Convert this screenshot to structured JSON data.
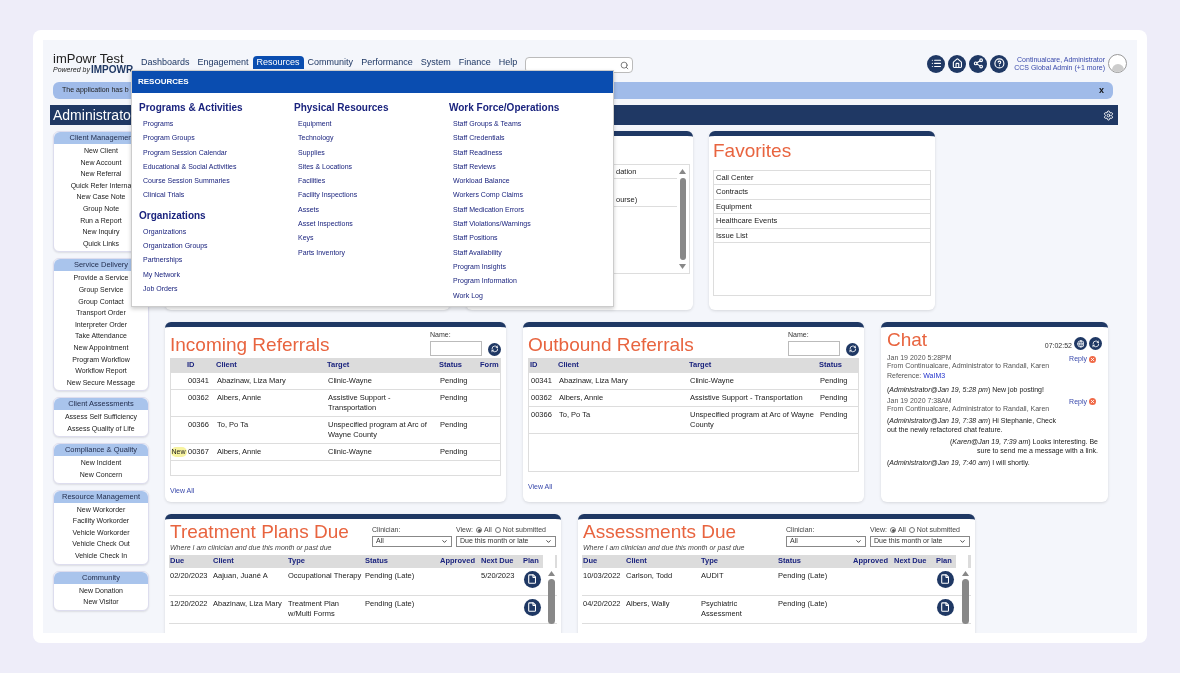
{
  "header": {
    "logo": {
      "title": "imPowr Test",
      "tagline": "Powered by",
      "brand": "IMPOWR"
    },
    "nav": [
      {
        "label": "Dashboards",
        "selected": false
      },
      {
        "label": "Engagement",
        "selected": false
      },
      {
        "label": "Resources",
        "selected": true
      },
      {
        "label": "Community",
        "selected": false
      },
      {
        "label": "Performance",
        "selected": false
      },
      {
        "label": "System",
        "selected": false
      },
      {
        "label": "Finance",
        "selected": false
      },
      {
        "label": "Help",
        "selected": false
      }
    ],
    "user": {
      "name": "Continualcare, Administrator",
      "role": "CCS Global Admin (+1 more)"
    }
  },
  "banner": {
    "text": "The application has b",
    "close": "x"
  },
  "page_title": "Administrato",
  "sidebar": [
    {
      "title": "Client Managemen",
      "items": [
        "New Client",
        "New Account",
        "New Referral",
        "Quick Refer Interna",
        "New Case Note",
        "Group Note",
        "Run a Report",
        "New Inquiry",
        "Quick Links"
      ]
    },
    {
      "title": "Service Delivery",
      "items": [
        "Provide a Service",
        "Group Service",
        "Group Contact",
        "Transport Order",
        "Interpreter Order",
        "Take Attendance",
        "New Appointment",
        "Program Workflow",
        "Workflow Report",
        "New Secure Message"
      ]
    },
    {
      "title": "Client Assessments",
      "items": [
        "Assess Self Sufficiency",
        "Assess Quality of Life"
      ]
    },
    {
      "title": "Compliance & Quality",
      "items": [
        "New Incident",
        "New Concern"
      ]
    },
    {
      "title": "Resource Management",
      "items": [
        "New Workorder",
        "Facility Workorder",
        "Vehicle Workorder",
        "Vehicle Check Out",
        "Vehicle Check In"
      ]
    },
    {
      "title": "Community",
      "items": [
        "New Donation",
        "New Visitor"
      ]
    }
  ],
  "dropdown": {
    "title": "RESOURCES",
    "columns": [
      [
        {
          "heading": "Programs & Activities",
          "links": [
            "Programs",
            "Program Groups",
            "Program Session Calendar",
            "Educational & Social Activities",
            "Course Session Summaries",
            "Clinical Trials"
          ]
        },
        {
          "heading": "Organizations",
          "links": [
            "Organizations",
            "Organization Groups",
            "Partnerships",
            "My Network",
            "Job Orders"
          ]
        }
      ],
      [
        {
          "heading": "Physical Resources",
          "links": [
            "Equipment",
            "Technology",
            "Supplies",
            "Sites & Locations",
            "Facilities",
            "Facility Inspections",
            "Assets",
            "Asset Inspections",
            "Keys",
            "Parts Inventory"
          ]
        }
      ],
      [
        {
          "heading": "Work Force/Operations",
          "links": [
            "Staff Groups & Teams",
            "Staff Credentials",
            "Staff Readiness",
            "Staff Reviews",
            "Workload Balance",
            "Workers Comp Claims",
            "Staff Medication Errors",
            "Staff Violations/Warnings",
            "Staff Positions",
            "Staff Availability",
            "Program Insights",
            "Program Information",
            "Work Log"
          ]
        }
      ]
    ]
  },
  "obscured_panel": {
    "rows": [
      "dation",
      "ourse)"
    ]
  },
  "favorites": {
    "title": "Favorites",
    "items": [
      "Call Center",
      "Contracts",
      "Equipment",
      "Healthcare Events",
      "Issue List"
    ]
  },
  "incoming_referrals": {
    "title": "Incoming Referrals",
    "name_label": "Name:",
    "columns": [
      "ID",
      "Client",
      "Target",
      "Status",
      "Form"
    ],
    "rows": [
      {
        "id": "00341",
        "client": "Abazinaw, Liza Mary",
        "target": "Clinic-Wayne",
        "status": "Pending"
      },
      {
        "id": "00362",
        "client": "Albers, Annie",
        "target": "Assistive Support - Transportation",
        "status": "Pending"
      },
      {
        "id": "00366",
        "client": "To, Po Ta",
        "target": "Unspecified program at Arc of Wayne County",
        "status": "Pending"
      },
      {
        "badge": "New",
        "id": "00367",
        "client": "Albers, Annie",
        "target": "Clinic-Wayne",
        "status": "Pending"
      }
    ],
    "view_all": "View All"
  },
  "outbound_referrals": {
    "title": "Outbound Referrals",
    "name_label": "Name:",
    "columns": [
      "ID",
      "Client",
      "Target",
      "Status"
    ],
    "rows": [
      {
        "id": "00341",
        "client": "Abazinaw, Liza Mary",
        "target": "Clinic-Wayne",
        "status": "Pending"
      },
      {
        "id": "00362",
        "client": "Albers, Annie",
        "target": "Assistive Support - Transportation",
        "status": "Pending"
      },
      {
        "id": "00366",
        "client": "To, Po Ta",
        "target": "Unspecified program at Arc of Wayne County",
        "status": "Pending"
      }
    ],
    "view_all": "View All"
  },
  "chat": {
    "title": "Chat",
    "time": "07:02:52",
    "messages": [
      {
        "date": "Jan 19 2020 5:28PM",
        "from": "From Continualcare, Administrator to Randall, Karen",
        "reference_label": "Reference:",
        "reference": "WaIM3",
        "reply": "Reply",
        "posts": [
          {
            "kind": "sent",
            "text": "(*Administrator@Jan 19, 5:28 pm*) New job posting!"
          }
        ]
      },
      {
        "date": "Jan 19 2020 7:38AM",
        "from": "From Continualcare, Administrator to Randall, Karen",
        "reply": "Reply",
        "posts": [
          {
            "kind": "sent",
            "text": "(*Administrator@Jan 19, 7:38 am*) Hi Stephanie, Check out the newly refactored chat feature."
          },
          {
            "kind": "received",
            "text": "(*Karen@Jan 19, 7:39 am*) Looks interesting. Be sure to send me a message with a link."
          },
          {
            "kind": "sent",
            "text": "(*Administrator@Jan 19, 7:40 am*) I will shortly."
          }
        ]
      }
    ]
  },
  "treatment_plans": {
    "title": "Treatment Plans Due",
    "subtitle": "Where I am clinician and due this month or past due",
    "clinician_label": "Clinician:",
    "clinician": "All",
    "view_label": "View:",
    "view_options": [
      {
        "label": "All",
        "selected": true
      },
      {
        "label": "Not submitted",
        "selected": false
      }
    ],
    "period": "Due this month or late",
    "columns": [
      "Due",
      "Client",
      "Type",
      "Status",
      "Approved",
      "Next Due",
      "Plan"
    ],
    "rows": [
      {
        "due": "02/20/2023",
        "client": "Aajuan, Juané A",
        "type": "Occupational Therapy",
        "status": "Pending (Late)",
        "next_due": "5/20/2023"
      },
      {
        "due": "12/20/2022",
        "client": "Abazinaw, Liza Mary",
        "type": "Treatment Plan w/Multi Forms",
        "status": "Pending (Late)"
      }
    ]
  },
  "assessments": {
    "title": "Assessments Due",
    "subtitle": "Where I am clinician and due this month or past due",
    "clinician_label": "Clinician:",
    "clinician": "All",
    "view_label": "View:",
    "view_options": [
      {
        "label": "All",
        "selected": true
      },
      {
        "label": "Not submitted",
        "selected": false
      }
    ],
    "period": "Due this month or late",
    "columns": [
      "Due",
      "Client",
      "Type",
      "Status",
      "Approved",
      "Next Due",
      "Plan"
    ],
    "rows": [
      {
        "due": "10/03/2022",
        "client": "Carlson, Todd",
        "type": "AUDIT",
        "status": "Pending (Late)"
      },
      {
        "due": "04/20/2022",
        "client": "Albers, Wally",
        "type": "Psychiatric Assessment",
        "status": "Pending (Late)"
      }
    ]
  }
}
